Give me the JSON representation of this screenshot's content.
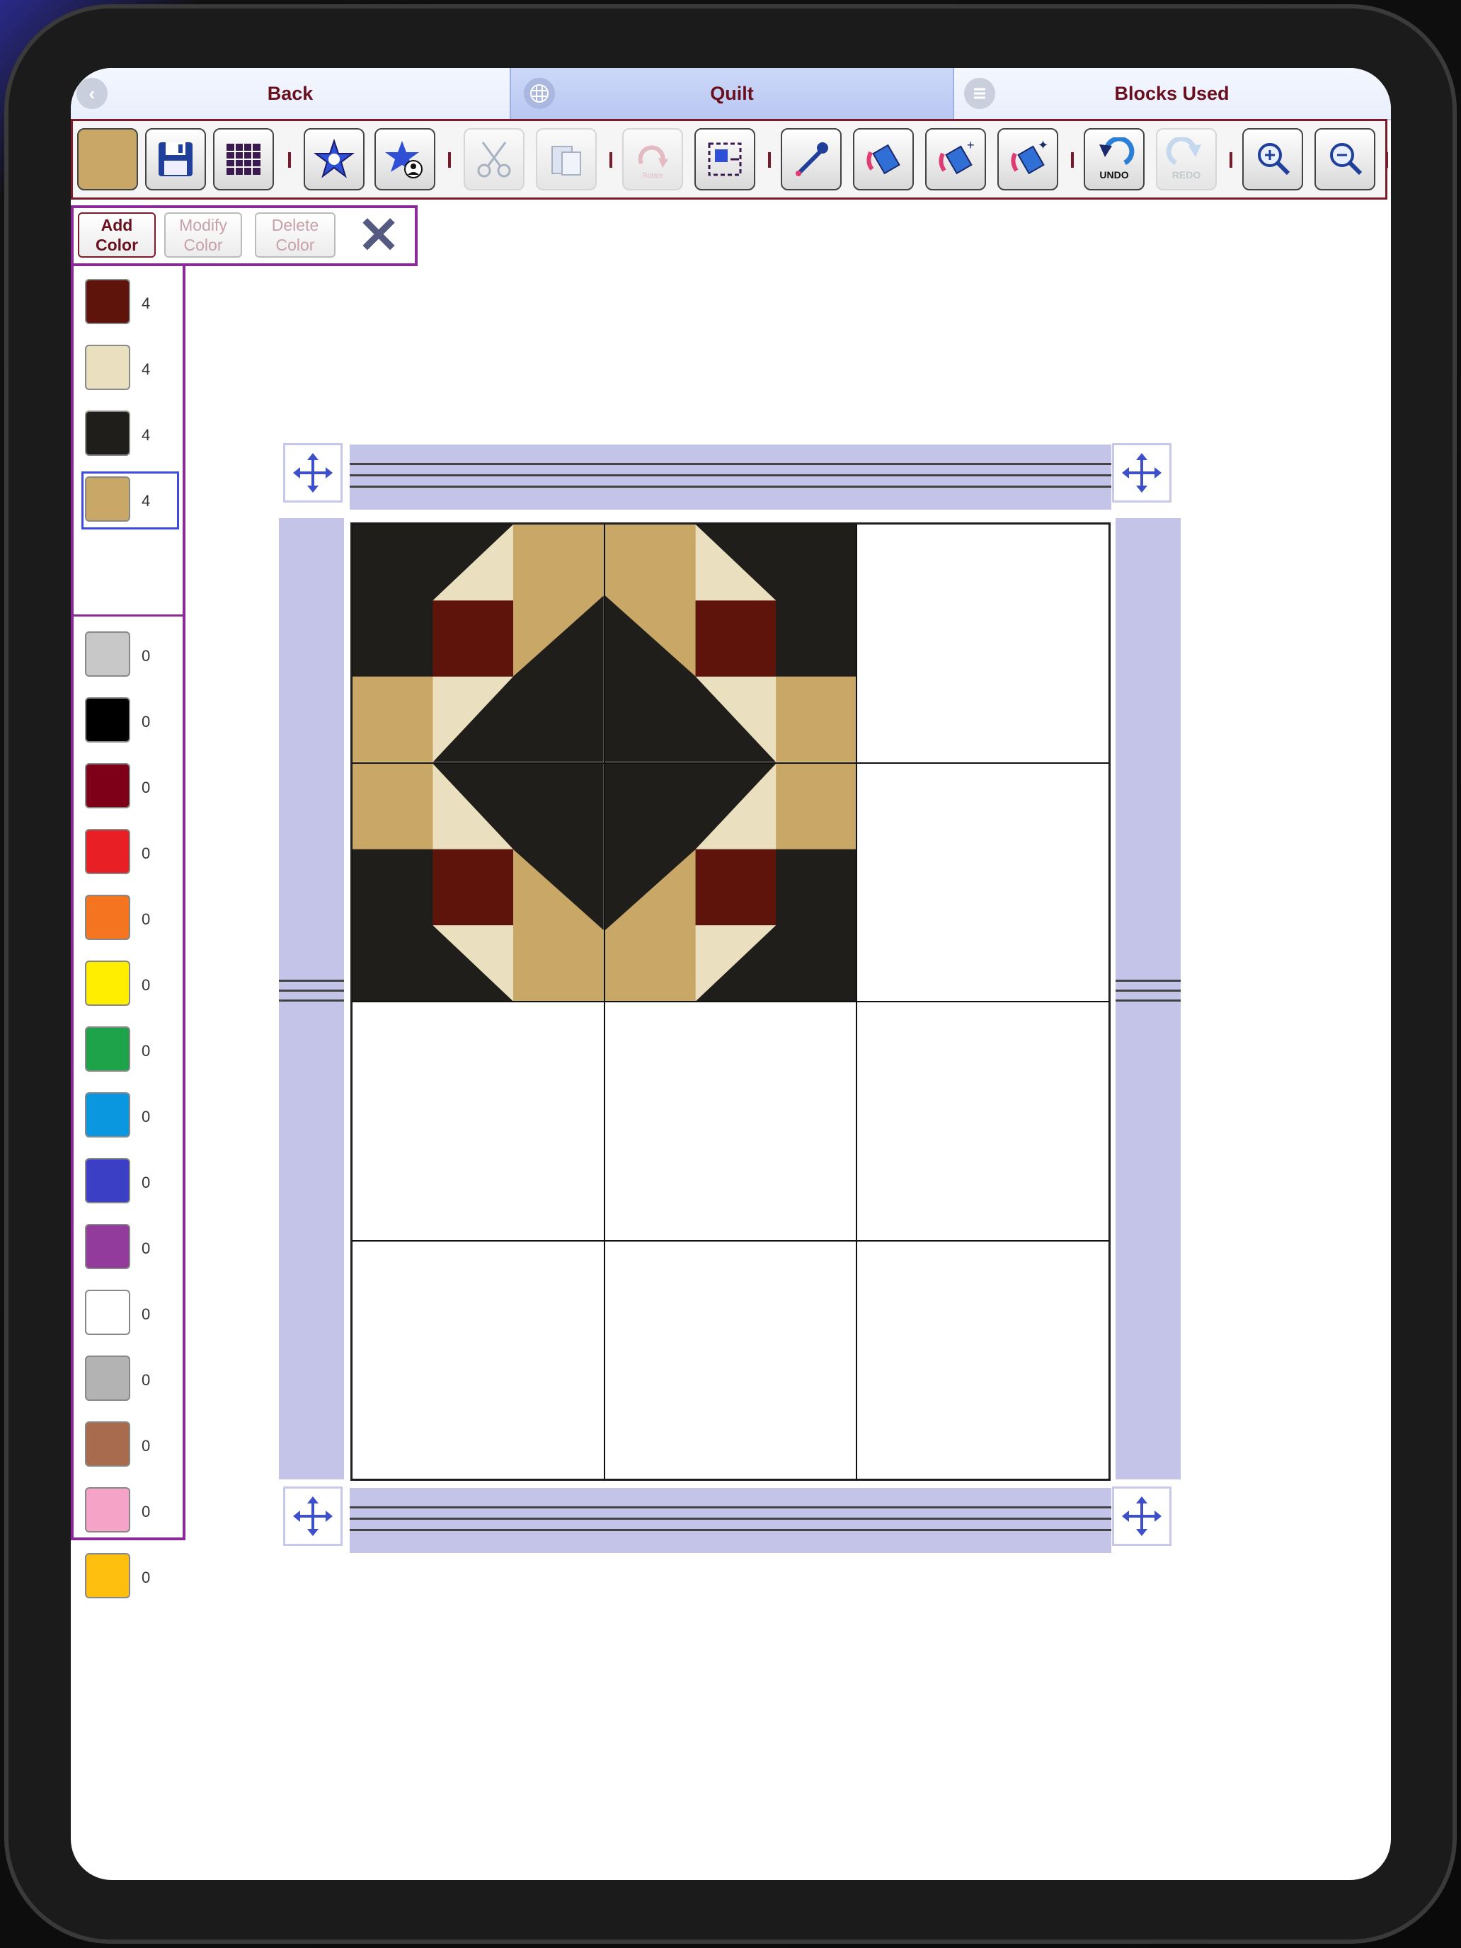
{
  "nav": {
    "back_label": "Back",
    "quilt_label": "Quilt",
    "blocks_label": "Blocks Used"
  },
  "toolbar": {
    "buttons": [
      {
        "name": "current-fabric-swatch",
        "icon": "fabric-swatch-icon",
        "enabled": true
      },
      {
        "name": "save-button",
        "icon": "floppy-disk-icon",
        "enabled": true
      },
      {
        "name": "grid-layout-button",
        "icon": "grid-icon",
        "enabled": true
      },
      {
        "name": "block-library-button",
        "icon": "star-block-icon",
        "enabled": true
      },
      {
        "name": "my-blocks-button",
        "icon": "star-user-icon",
        "enabled": true
      },
      {
        "name": "cut-button",
        "icon": "scissors-icon",
        "enabled": false
      },
      {
        "name": "paste-button",
        "icon": "paste-icon",
        "enabled": false
      },
      {
        "name": "rotate-button",
        "icon": "rotate-icon",
        "enabled": false
      },
      {
        "name": "select-area-button",
        "icon": "select-area-icon",
        "enabled": true
      },
      {
        "name": "eyedropper-button",
        "icon": "eyedropper-icon",
        "enabled": true
      },
      {
        "name": "fill-button",
        "icon": "paint-bucket-icon",
        "enabled": true
      },
      {
        "name": "fill-block-button",
        "icon": "paint-bucket-plus-icon",
        "enabled": true
      },
      {
        "name": "fill-all-button",
        "icon": "paint-bucket-sparkle-icon",
        "enabled": true
      },
      {
        "name": "undo-button",
        "icon": "undo-icon",
        "enabled": true
      },
      {
        "name": "redo-button",
        "icon": "redo-icon",
        "enabled": false
      },
      {
        "name": "zoom-in-button",
        "icon": "zoom-in-icon",
        "enabled": true
      },
      {
        "name": "zoom-out-button",
        "icon": "zoom-out-icon",
        "enabled": true
      }
    ],
    "rotate_text": "Rotate",
    "undo_text": "UNDO",
    "redo_text": "REDO"
  },
  "color_bar": {
    "add_line1": "Add",
    "add_line2": "Color",
    "modify_line1": "Modify",
    "modify_line2": "Color",
    "delete_line1": "Delete",
    "delete_line2": "Color",
    "close_icon": "close-icon",
    "close_glyph": "✕"
  },
  "palette": {
    "used": [
      {
        "color": "#5e140b",
        "count": "4"
      },
      {
        "color": "#eadfbf",
        "count": "4"
      },
      {
        "color": "#1f1e1b",
        "count": "4"
      },
      {
        "color": "#c8a767",
        "count": "4",
        "selected": true
      }
    ],
    "unused": [
      {
        "color": "#c8c8c8",
        "count": "0"
      },
      {
        "color": "#000000",
        "count": "0"
      },
      {
        "color": "#7d0018",
        "count": "0"
      },
      {
        "color": "#e81f25",
        "count": "0"
      },
      {
        "color": "#f47420",
        "count": "0"
      },
      {
        "color": "#ffee00",
        "count": "0"
      },
      {
        "color": "#1fa34a",
        "count": "0"
      },
      {
        "color": "#0a97e0",
        "count": "0"
      },
      {
        "color": "#3a3fc6",
        "count": "0"
      },
      {
        "color": "#923b9c",
        "count": "0"
      },
      {
        "color": "#ffffff",
        "count": "0"
      },
      {
        "color": "#b3b3b3",
        "count": "0"
      },
      {
        "color": "#a86b4d",
        "count": "0"
      },
      {
        "color": "#f5a3c6",
        "count": "0"
      },
      {
        "color": "#ffbf0f",
        "count": "0"
      }
    ]
  },
  "quilt": {
    "columns": 3,
    "rows": 4,
    "filled_block": "2x2 pieced block (dark, cream, maroon, tan)",
    "colors": {
      "dark": "#1f1e1b",
      "cream": "#eadfbf",
      "maroon": "#5e140b",
      "tan": "#c8a767"
    },
    "border_color": "#c3c4e8",
    "move_icon": "move-arrows-icon"
  }
}
